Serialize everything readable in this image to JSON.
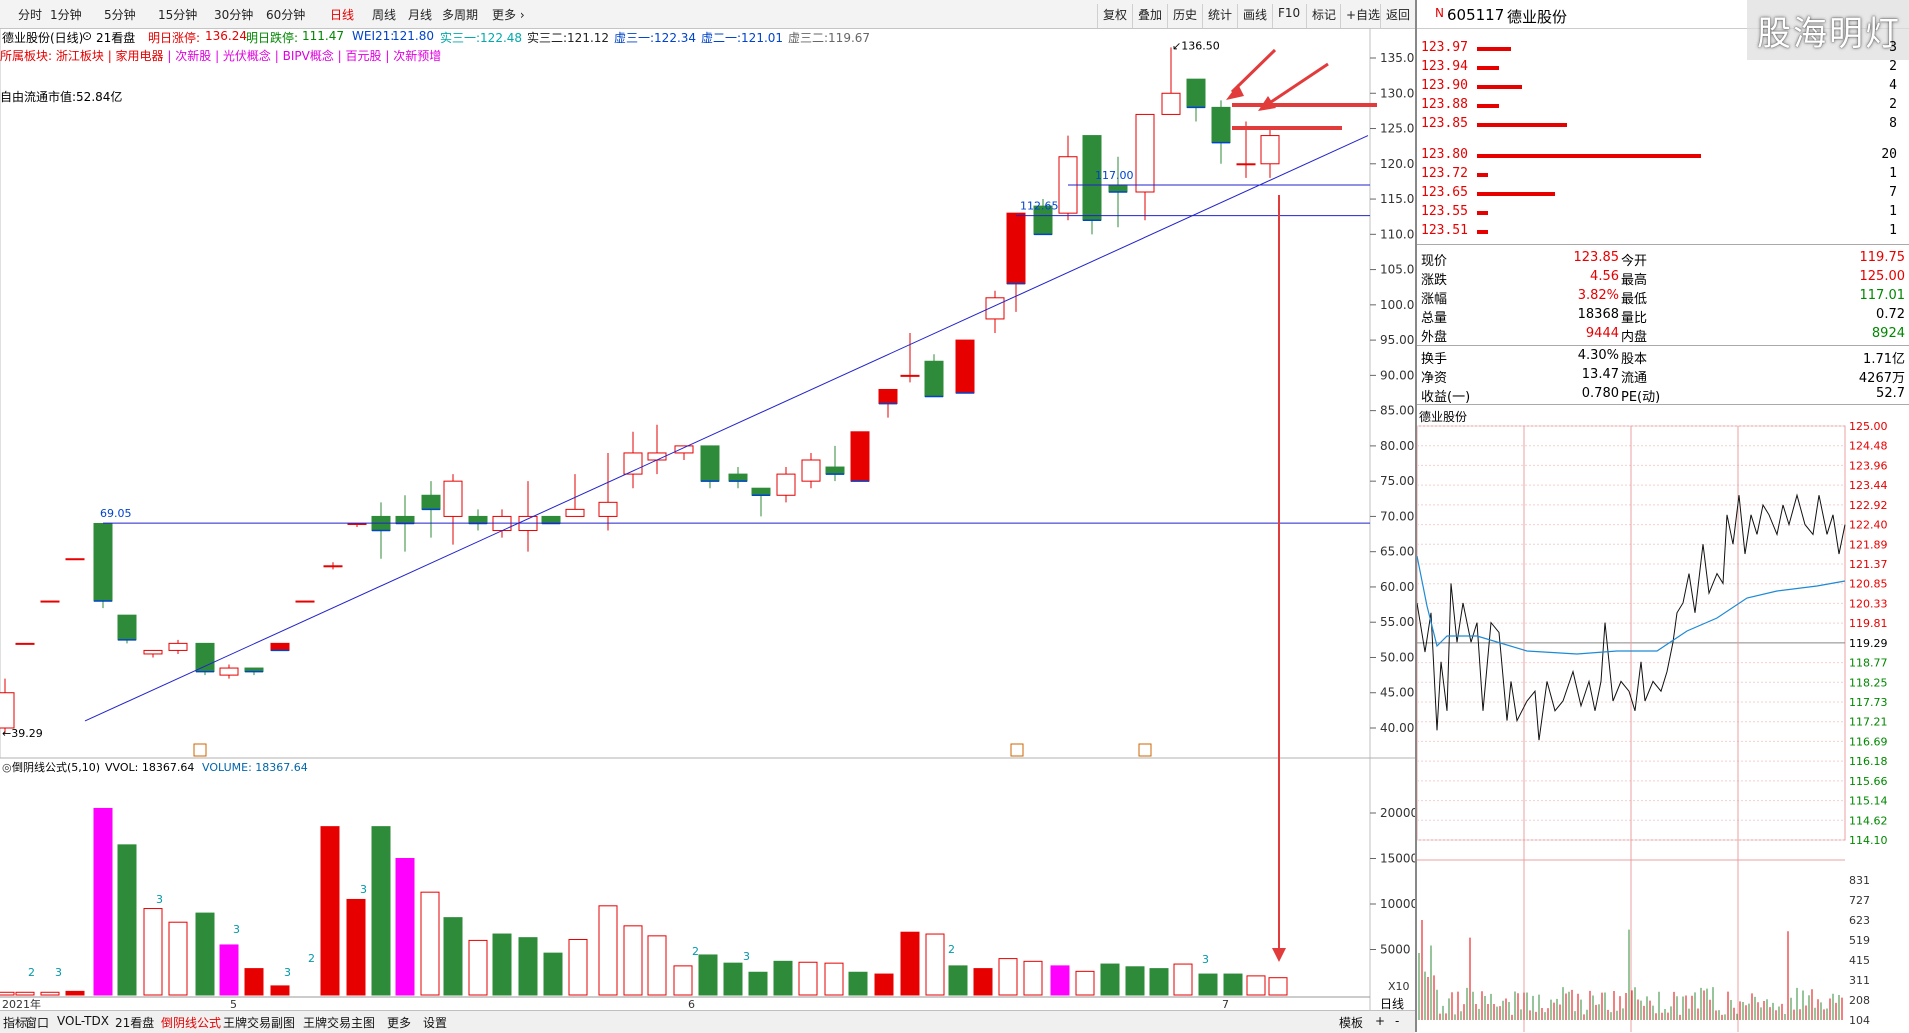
{
  "toolbar": {
    "periods": [
      "分时",
      "1分钟",
      "5分钟",
      "15分钟",
      "30分钟",
      "60分钟",
      "日线",
      "周线",
      "月线",
      "多周期",
      "更多"
    ],
    "active_period": "日线",
    "right_tools": [
      "复权",
      "叠加",
      "历史",
      "统计",
      "画线",
      "F10",
      "标记",
      "+自选",
      "返回"
    ]
  },
  "stock": {
    "code": "605117",
    "name": "德业股份",
    "title": "德业股份(日线)",
    "indicator_title": "21看盘",
    "limit_up_label": "明日涨停:",
    "limit_up": "136.24",
    "limit_down_label": "明日跌停:",
    "limit_down": "111.47",
    "wei_label": "WEI21:",
    "wei": "121.80",
    "ma_items": [
      {
        "label": "实三一:",
        "value": "122.48",
        "color": "#00aaaa"
      },
      {
        "label": "实三二:",
        "value": "121.12",
        "color": "#222222"
      },
      {
        "label": "虚三一:",
        "value": "122.34",
        "color": "#0044cc"
      },
      {
        "label": "虚二一:",
        "value": "121.01",
        "color": "#0044cc"
      },
      {
        "label": "虚三二:",
        "value": "119.67",
        "color": "#666666"
      }
    ],
    "sector_prefix": "所属板块:",
    "sectors": [
      "浙江板块",
      "家用电器",
      "次新股",
      "光伏概念",
      "BIPV概念",
      "百元股",
      "次新预增"
    ],
    "float_mv_label": "自由流通市值:",
    "float_mv": "52.84亿",
    "watermark": "股海明灯"
  },
  "price_axis": [
    "135.0",
    "130.0",
    "125.0",
    "120.0",
    "115.0",
    "110.0",
    "105.0",
    "100.0",
    "95.00",
    "90.00",
    "85.00",
    "80.00",
    "75.00",
    "70.00",
    "65.00",
    "60.00",
    "55.00",
    "50.00",
    "45.00",
    "40.00"
  ],
  "annotations": {
    "high": "136.50",
    "low": "39.29",
    "first_line": "69.05",
    "mid1": "112.65",
    "mid2": "117.00"
  },
  "volume_panel": {
    "title": "倒阴线公式(5,10)",
    "vvol_label": "VVOL:",
    "vvol": "18367.64",
    "volume_label": "VOLUME:",
    "volume": "18367.64",
    "axis": [
      "20000",
      "15000",
      "10000",
      "5000"
    ],
    "multiplier": "X10",
    "marker_3": "3",
    "marker_2": "2"
  },
  "date_axis": {
    "year": "2021年",
    "m5": "5",
    "m6": "6",
    "m7": "7"
  },
  "bottom_tabs": [
    "指标",
    "窗口",
    "VOL-TDX",
    "21看盘",
    "倒阴线公式",
    "王牌交易副图",
    "王牌交易主图",
    "更多",
    "设置"
  ],
  "bottom_active": "倒阴线公式",
  "bottom_right": {
    "mode": "模板",
    "plus": "+",
    "minus": "-",
    "period": "日线"
  },
  "order_book": {
    "sell": [
      {
        "price": "123.97",
        "vol": "3",
        "bar": 0.12
      },
      {
        "price": "123.94",
        "vol": "2",
        "bar": 0.08
      },
      {
        "price": "123.90",
        "vol": "4",
        "bar": 0.16
      },
      {
        "price": "123.88",
        "vol": "2",
        "bar": 0.08
      },
      {
        "price": "123.85",
        "vol": "8",
        "bar": 0.32
      }
    ],
    "buy": [
      {
        "price": "123.80",
        "vol": "20",
        "bar": 0.8
      },
      {
        "price": "123.72",
        "vol": "1",
        "bar": 0.04
      },
      {
        "price": "123.65",
        "vol": "7",
        "bar": 0.28
      },
      {
        "price": "123.55",
        "vol": "1",
        "bar": 0.04
      },
      {
        "price": "123.51",
        "vol": "1",
        "bar": 0.04
      }
    ]
  },
  "quote": [
    {
      "l1": "现价",
      "v1": "123.85",
      "c1": "red",
      "l2": "今开",
      "v2": "119.75",
      "c2": "red"
    },
    {
      "l1": "涨跌",
      "v1": "4.56",
      "c1": "red",
      "l2": "最高",
      "v2": "125.00",
      "c2": "red"
    },
    {
      "l1": "涨幅",
      "v1": "3.82%",
      "c1": "red",
      "l2": "最低",
      "v2": "117.01",
      "c2": "green"
    },
    {
      "l1": "总量",
      "v1": "18368",
      "c1": "black",
      "l2": "量比",
      "v2": "0.72",
      "c2": "black"
    },
    {
      "l1": "外盘",
      "v1": "9444",
      "c1": "red",
      "l2": "内盘",
      "v2": "8924",
      "c2": "green"
    },
    {
      "l1": "换手",
      "v1": "4.30%",
      "c1": "black",
      "l2": "股本",
      "v2": "1.71亿",
      "c2": "black"
    },
    {
      "l1": "净资",
      "v1": "13.47",
      "c1": "black",
      "l2": "流通",
      "v2": "4267万",
      "c2": "black"
    },
    {
      "l1": "收益(一)",
      "v1": "0.780",
      "c1": "black",
      "l2": "PE(动)",
      "v2": "52.7",
      "c2": "black"
    }
  ],
  "intraday": {
    "name": "德业股份",
    "axis": [
      "125.00",
      "124.48",
      "123.96",
      "123.44",
      "122.92",
      "122.40",
      "121.89",
      "121.37",
      "120.85",
      "120.33",
      "119.81",
      "119.29",
      "118.77",
      "118.25",
      "117.73",
      "117.21",
      "116.69",
      "116.18",
      "115.66",
      "115.14",
      "114.62",
      "114.10"
    ],
    "vol_axis": [
      "831",
      "727",
      "623",
      "519",
      "415",
      "311",
      "208",
      "104"
    ]
  }
}
